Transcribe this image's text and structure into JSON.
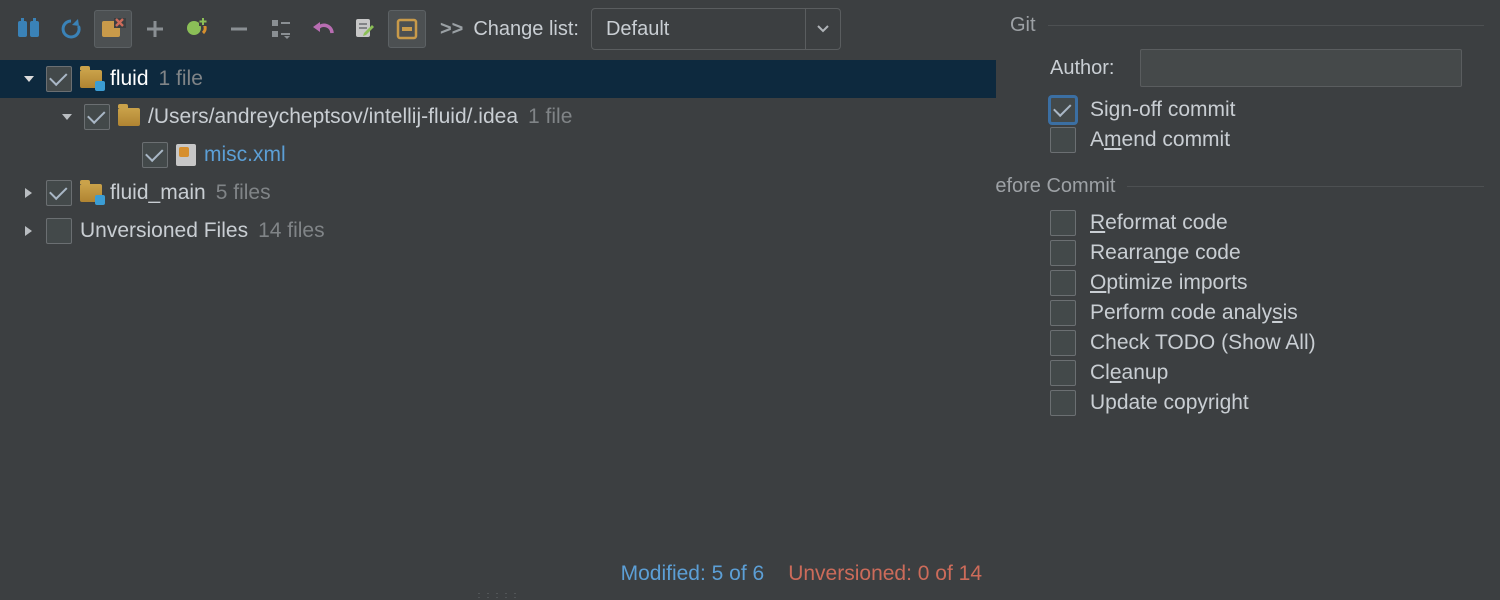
{
  "toolbar": {
    "changelist_label": "Change list:",
    "changelist_value": "Default"
  },
  "tree": [
    {
      "name": "fluid",
      "count": "1 file",
      "checked": true,
      "expanded": true,
      "children": [
        {
          "name": "/Users/andreycheptsov/intellij-fluid/.idea",
          "count": "1 file",
          "checked": true,
          "expanded": true,
          "children": [
            {
              "name": "misc.xml",
              "checked": true
            }
          ]
        }
      ]
    },
    {
      "name": "fluid_main",
      "count": "5 files",
      "checked": true,
      "expanded": false
    },
    {
      "name": "Unversioned Files",
      "count": "14 files",
      "checked": false,
      "expanded": false
    }
  ],
  "status": {
    "modified": "Modified: 5 of 6",
    "unversioned": "Unversioned: 0 of 14"
  },
  "git": {
    "section": "Git",
    "author_label": "Author:",
    "author_value": "",
    "sign_off": "Sign-off commit",
    "sign_off_checked": true,
    "amend": "Amend commit",
    "amend_checked": false
  },
  "before": {
    "section": "Before Commit",
    "reformat": "Reformat code",
    "rearrange": "Rearrange code",
    "optimize": "Optimize imports",
    "analysis": "Perform code analysis",
    "todo": "Check TODO (Show All)",
    "cleanup": "Cleanup",
    "copyright": "Update copyright"
  }
}
